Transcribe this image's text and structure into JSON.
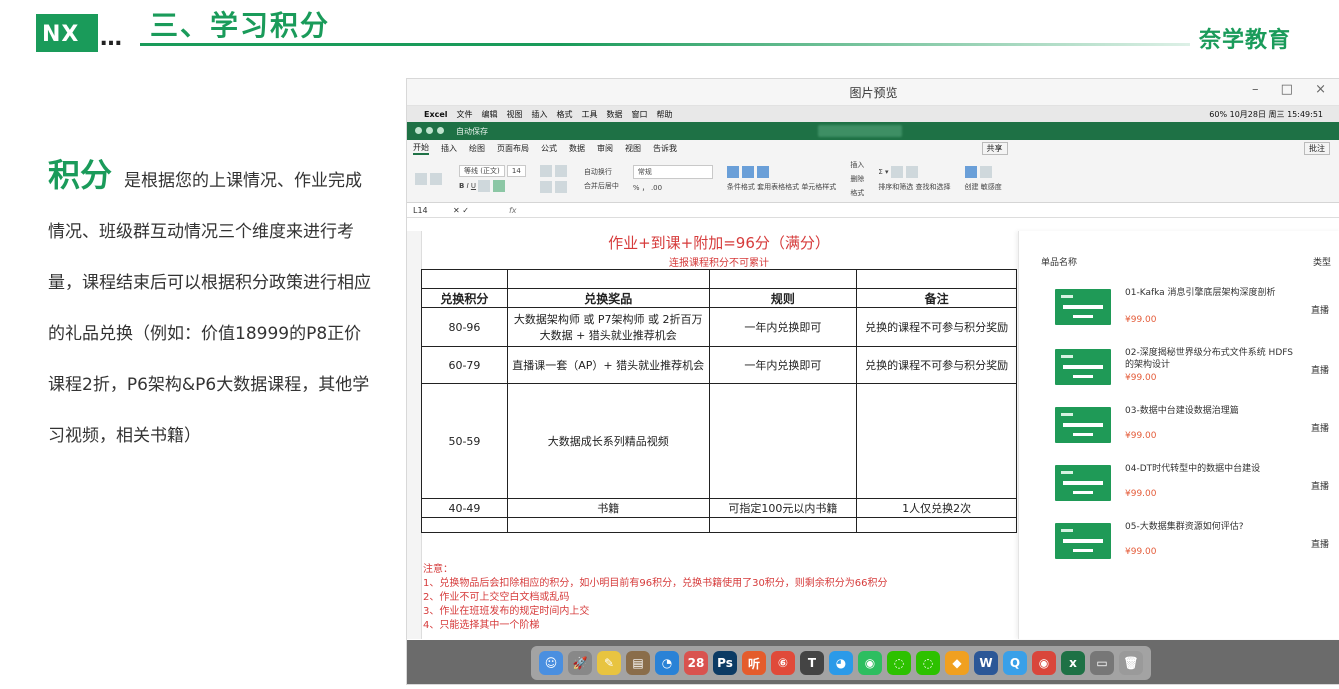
{
  "slide": {
    "logo_text": "NX",
    "logo_dots": "…",
    "title": "三、学习积分",
    "brand": "奈学教育"
  },
  "intro": {
    "keyword": "积分",
    "text": "是根据您的上课情况、作业完成情况、班级群互动情况三个维度来进行考量，课程结束后可以根据积分政策进行相应的礼品兑换（例如：价值18999的P8正价课程2折，P6架构&P6大数据课程，其他学习视频，相关书籍）"
  },
  "window": {
    "title": "图片预览",
    "controls": [
      "–",
      "□",
      "×"
    ]
  },
  "mac_menu": {
    "apple": "",
    "items": [
      "Excel",
      "文件",
      "编辑",
      "视图",
      "插入",
      "格式",
      "工具",
      "数据",
      "窗口",
      "帮助"
    ],
    "status": "60%  10月28日 周三 15:49:51"
  },
  "excel": {
    "autosave": "自动保存",
    "tabs": [
      "开始",
      "插入",
      "绘图",
      "页面布局",
      "公式",
      "数据",
      "审阅",
      "视图",
      "告诉我"
    ],
    "share": "共享",
    "comment": "批注",
    "font_name": "等线 (正文)",
    "font_size": "14",
    "wrap": "自动换行",
    "merge": "合并后居中",
    "number_format": "常规",
    "cond_format": "条件格式",
    "table_format": "套用表格格式",
    "cell_style": "单元格样式",
    "insert": "插入",
    "delete": "删除",
    "format": "格式",
    "sort": "排序和筛选",
    "find": "查找和选择",
    "create": "创建",
    "sensitivity": "敏感度",
    "cell_ref": "L14",
    "fx": "fx"
  },
  "sheet": {
    "title": "作业+到课+附加=96分（满分）",
    "subtitle": "连报课程积分不可累计",
    "headers": [
      "兑换积分",
      "兑换奖品",
      "规则",
      "备注"
    ],
    "rows": [
      {
        "points": "80-96",
        "prize": "大数据架构师 或 P7架构师 或 2折百万大数据 + 猎头就业推荐机会",
        "rule": "一年内兑换即可",
        "note": "兑换的课程不可参与积分奖励"
      },
      {
        "points": "60-79",
        "prize": "直播课一套（AP）+ 猎头就业推荐机会",
        "rule": "一年内兑换即可",
        "note": "兑换的课程不可参与积分奖励"
      },
      {
        "points": "50-59",
        "prize": "大数据成长系列精品视频",
        "rule": "",
        "note": ""
      },
      {
        "points": "40-49",
        "prize": "书籍",
        "rule": "可指定100元以内书籍",
        "note": "1人仅兑换2次"
      }
    ],
    "notes": [
      "注意：",
      "1、兑换物品后会扣除相应的积分，如小明目前有96积分，兑换书籍使用了30积分，则剩余积分为66积分",
      "2、作业不可上交空白文档或乱码",
      "3、作业在班班发布的规定时间内上交",
      "4、只能选择其中一个阶梯"
    ]
  },
  "products": {
    "col_name": "单品名称",
    "col_type": "类型",
    "items": [
      {
        "name": "01-Kafka 消息引擎底层架构深度剖析",
        "price": "¥99.00",
        "type": "直播"
      },
      {
        "name": "02-深度揭秘世界级分布式文件系统 HDFS 的架构设计",
        "price": "¥99.00",
        "type": "直播"
      },
      {
        "name": "03-数据中台建设数据治理篇",
        "price": "¥99.00",
        "type": "直播"
      },
      {
        "name": "04-DT时代转型中的数据中台建设",
        "price": "¥99.00",
        "type": "直播"
      },
      {
        "name": "05-大数据集群资源如何评估?",
        "price": "¥99.00",
        "type": "直播"
      }
    ]
  },
  "dock": {
    "items": [
      {
        "icon": "finder-icon",
        "glyph": "☺",
        "color": "#4a8fe0"
      },
      {
        "icon": "launchpad-icon",
        "glyph": "🚀",
        "color": "#888888"
      },
      {
        "icon": "notes-icon",
        "glyph": "✎",
        "color": "#e8c440"
      },
      {
        "icon": "notebook-icon",
        "glyph": "▤",
        "color": "#8a6d4a"
      },
      {
        "icon": "safari-icon",
        "glyph": "◔",
        "color": "#2a82d6"
      },
      {
        "icon": "calendar-icon",
        "glyph": "28",
        "color": "#d9534f"
      },
      {
        "icon": "photoshop-icon",
        "glyph": "Ps",
        "color": "#0c3b64"
      },
      {
        "icon": "audio-icon",
        "glyph": "听",
        "color": "#e45c2c"
      },
      {
        "icon": "weibo-icon",
        "glyph": "⑥",
        "color": "#e04a3a"
      },
      {
        "icon": "typora-icon",
        "glyph": "T",
        "color": "#444444"
      },
      {
        "icon": "qq-icon",
        "glyph": "◕",
        "color": "#2b9ae8"
      },
      {
        "icon": "evernote-icon",
        "glyph": "◉",
        "color": "#2dbe60"
      },
      {
        "icon": "wechat-icon",
        "glyph": "◌",
        "color": "#2dc100"
      },
      {
        "icon": "wechat-work-icon",
        "glyph": "◌",
        "color": "#2dc100"
      },
      {
        "icon": "sketch-icon",
        "glyph": "◆",
        "color": "#f0a020"
      },
      {
        "icon": "word-icon",
        "glyph": "W",
        "color": "#2b5797"
      },
      {
        "icon": "qq-browser-icon",
        "glyph": "Q",
        "color": "#3aa0e8"
      },
      {
        "icon": "chrome-icon",
        "glyph": "◉",
        "color": "#d9463b"
      },
      {
        "icon": "excel-icon",
        "glyph": "x",
        "color": "#1e7145"
      },
      {
        "icon": "window-icon",
        "glyph": "▭",
        "color": "#777777"
      },
      {
        "icon": "trash-icon",
        "glyph": "🗑",
        "color": "#9a9a9a"
      }
    ]
  }
}
